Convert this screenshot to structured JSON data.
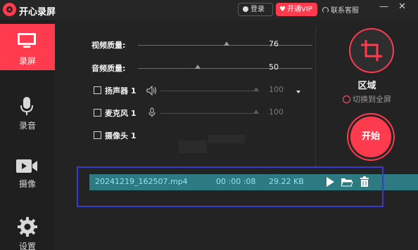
{
  "app": {
    "title": "开心录屏"
  },
  "header": {
    "login_label": "登录",
    "vip_label": "开通VIP",
    "support_label": "联系客服"
  },
  "sidebar": {
    "items": [
      {
        "label": "录屏",
        "icon": "monitor-icon",
        "active": true
      },
      {
        "label": "录音",
        "icon": "microphone-icon",
        "active": false
      },
      {
        "label": "摄像",
        "icon": "camera-icon",
        "active": false
      },
      {
        "label": "设置",
        "icon": "gear-icon",
        "active": false
      }
    ]
  },
  "settings": {
    "video_quality": {
      "label": "视频质量:",
      "value": "76"
    },
    "audio_quality": {
      "label": "音频质量:",
      "value": "50"
    },
    "speaker": {
      "label": "扬声器 1",
      "value": "100",
      "checked": false
    },
    "microphone": {
      "label": "麦克风 1",
      "value": "100",
      "checked": false
    },
    "webcam": {
      "label": "摄像头 1",
      "checked": false
    }
  },
  "capture": {
    "area_label": "区域",
    "switch_label": "切换到全屏",
    "start_label": "开始"
  },
  "recordings": [
    {
      "filename": "20241219_162507.mp4",
      "duration": "00 :00 :08",
      "size": "29.22 KB"
    }
  ],
  "colors": {
    "accent": "#ff3b4d",
    "row_highlight": "#2d7a83",
    "row_text": "#8ee6f0"
  }
}
